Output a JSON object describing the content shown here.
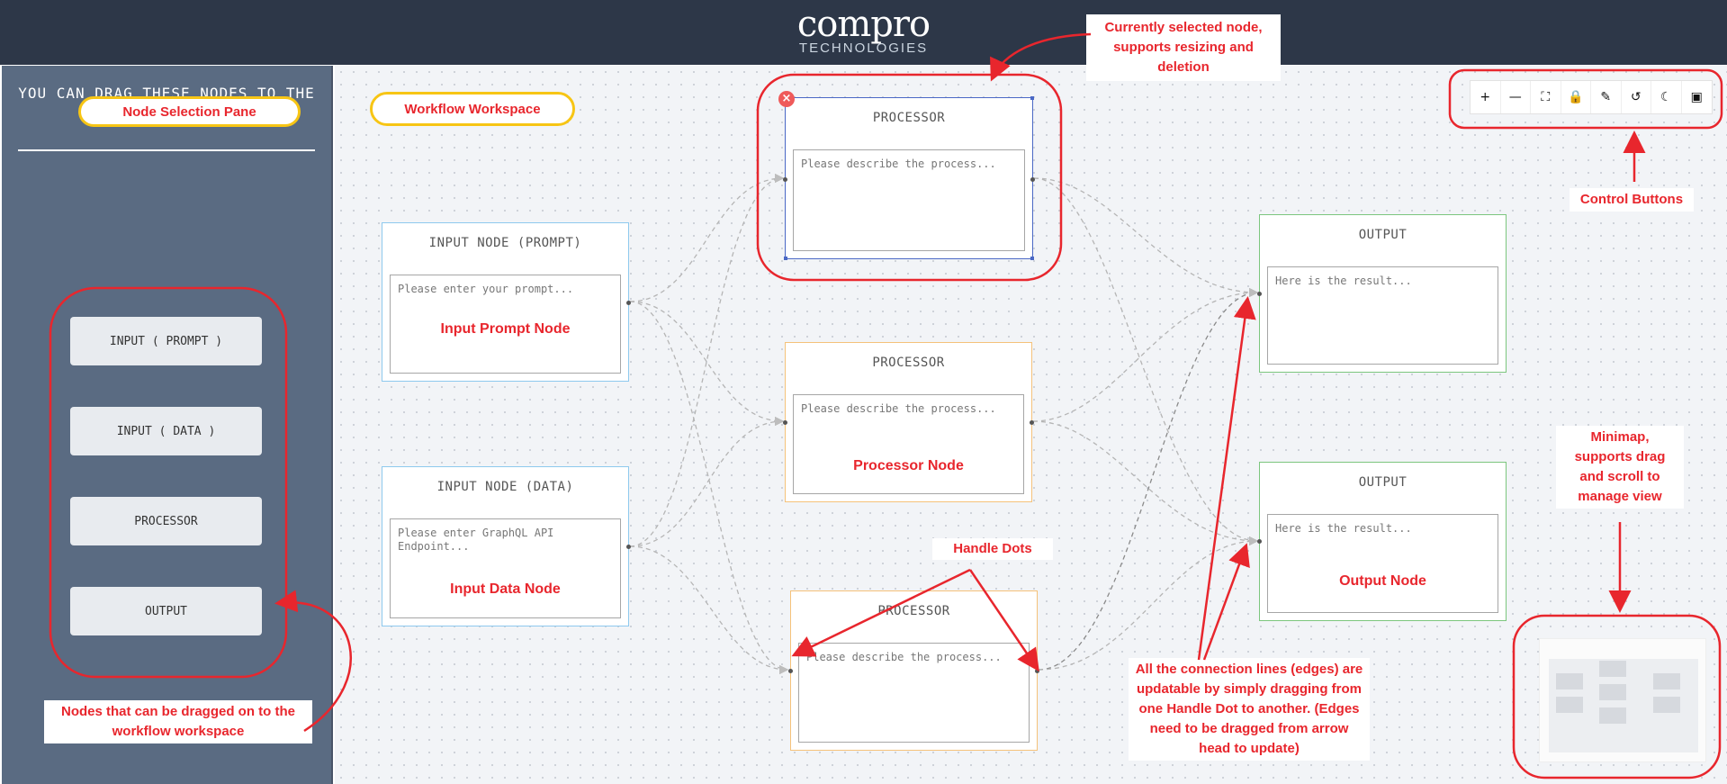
{
  "header": {
    "logo_main": "compro",
    "logo_sub": "TECHNOLOGIES"
  },
  "sidebar": {
    "title": "YOU CAN DRAG THESE NODES TO THE PANE.",
    "items": [
      {
        "label": "INPUT ( PROMPT )"
      },
      {
        "label": "INPUT ( DATA )"
      },
      {
        "label": "PROCESSOR"
      },
      {
        "label": "OUTPUT"
      }
    ]
  },
  "nodes": {
    "input_prompt": {
      "title": "INPUT NODE (PROMPT)",
      "placeholder": "Please enter your prompt..."
    },
    "input_data": {
      "title": "INPUT NODE (DATA)",
      "placeholder": "Please enter GraphQL API Endpoint..."
    },
    "processor_1": {
      "title": "PROCESSOR",
      "placeholder": "Please describe the process..."
    },
    "processor_2": {
      "title": "PROCESSOR",
      "placeholder": "Please describe the process..."
    },
    "processor_3": {
      "title": "PROCESSOR",
      "placeholder": "Please describe the process..."
    },
    "output_1": {
      "title": "OUTPUT",
      "placeholder": "Here is the result..."
    },
    "output_2": {
      "title": "OUTPUT",
      "placeholder": "Here is the result..."
    }
  },
  "controls": [
    {
      "icon": "plus-icon",
      "glyph": "+"
    },
    {
      "icon": "minus-icon",
      "glyph": "—"
    },
    {
      "icon": "fit-view-icon",
      "glyph": "⛶"
    },
    {
      "icon": "lock-icon",
      "glyph": "🔒"
    },
    {
      "icon": "eraser-icon",
      "glyph": "✎"
    },
    {
      "icon": "undo-icon",
      "glyph": "↺"
    },
    {
      "icon": "moon-icon",
      "glyph": "☾"
    },
    {
      "icon": "terminal-icon",
      "glyph": "▣"
    }
  ],
  "annotations": {
    "node_selection_pane": "Node Selection Pane",
    "workflow_workspace": "Workflow Workspace",
    "selected_node": "Currently selected node, supports resizing and deletion",
    "control_buttons": "Control Buttons",
    "input_prompt_node": "Input Prompt Node",
    "input_data_node": "Input Data Node",
    "processor_node": "Processor Node",
    "output_node": "Output Node",
    "handle_dots": "Handle Dots",
    "minimap": "Minimap, supports drag and scroll to manage view",
    "draggable_nodes": "Nodes that can be dragged on to the workflow workspace",
    "edges": "All the connection lines (edges) are updatable by simply dragging from one Handle Dot to another. (Edges need to be dragged from arrow head to update)"
  },
  "colors": {
    "header_bg": "#2d3748",
    "sidebar_bg": "#5a6b82",
    "annotation_red": "#e8262d",
    "annotation_yellow": "#f7c514",
    "input_border": "#8ec9ee",
    "processor_border": "#f5c27a",
    "output_border": "#7cc67e",
    "selected_border": "#4a68c5"
  }
}
